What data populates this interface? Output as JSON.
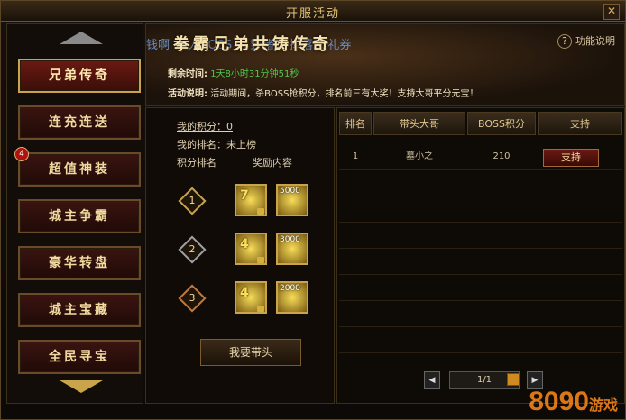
{
  "window": {
    "title": "开服活动",
    "close_label": "✕"
  },
  "sidebar": {
    "badge_count": "4",
    "items": [
      {
        "label": "兄弟传奇",
        "active": true
      },
      {
        "label": "连充连送",
        "active": false
      },
      {
        "label": "超值神装",
        "active": false
      },
      {
        "label": "城主争霸",
        "active": false
      },
      {
        "label": "豪华转盘",
        "active": false
      },
      {
        "label": "城主宝藏",
        "active": false
      },
      {
        "label": "全民寻宝",
        "active": false
      }
    ]
  },
  "banner": {
    "title": "拳霸兄弟共铸传奇",
    "scrolling_text": "钱啊 ... 人BOSS ... 野猪王 掉落50礼券",
    "help_label": "功能说明",
    "time_label": "剩余时间:",
    "time_value": "1天8小时31分钟51秒",
    "desc_label": "活动说明:",
    "desc_value": "活动期间，杀BOSS抢积分，排名前三有大奖！支持大哥平分元宝！"
  },
  "rewards": {
    "my_points": "我的积分：0",
    "my_rank": "我的排名：未上榜",
    "col_rank": "积分排名",
    "col_reward": "奖励内容",
    "tiers": [
      {
        "rank": "1",
        "item_count": "7",
        "gold": "5000"
      },
      {
        "rank": "2",
        "item_count": "4",
        "gold": "3000"
      },
      {
        "rank": "3",
        "item_count": "4",
        "gold": "2000"
      }
    ],
    "lead_button": "我要带头"
  },
  "table": {
    "headers": [
      "排名",
      "带头大哥",
      "BOSS积分",
      "支持"
    ],
    "rows": [
      {
        "rank": "1",
        "name": "墓小之",
        "points": "210",
        "action": "支持"
      }
    ],
    "pager": {
      "info": "1/1",
      "prev": "◀",
      "next": "▶"
    }
  },
  "watermark": {
    "text": "8090",
    "suffix": "游戏"
  }
}
